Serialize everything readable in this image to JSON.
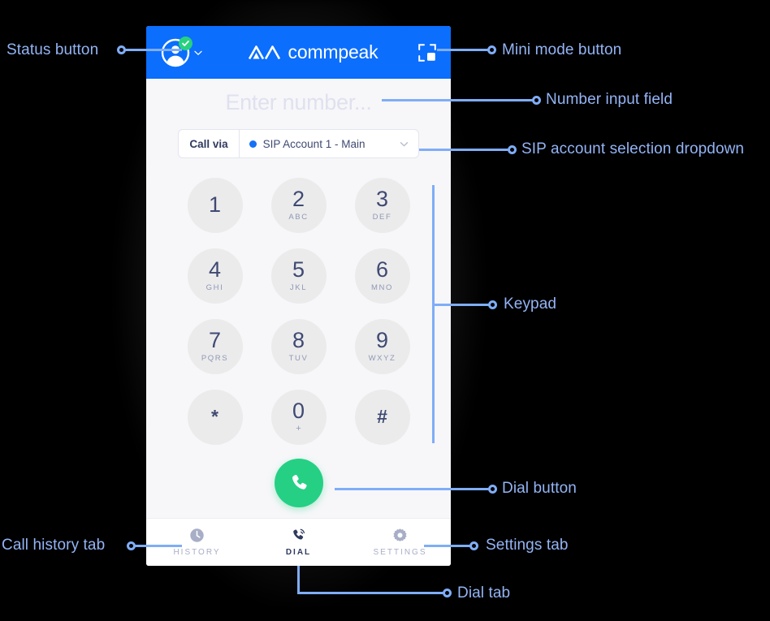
{
  "app": {
    "brand_name": "commpeak",
    "header": {
      "status_button_name": "status-button",
      "avatar_icon": "avatar-icon",
      "badge_icon": "check-badge-icon",
      "chevron_icon": "chevron-down-icon",
      "mini_mode_icon": "mini-mode-icon"
    },
    "number_input": {
      "value": "",
      "placeholder": "Enter number..."
    },
    "call_via": {
      "label": "Call via",
      "selected_account": "SIP Account 1 - Main",
      "status_dot_color": "#1571f5",
      "chevron_icon": "chevron-down-icon"
    },
    "keypad": {
      "keys": [
        {
          "digit": "1",
          "letters": ""
        },
        {
          "digit": "2",
          "letters": "ABC"
        },
        {
          "digit": "3",
          "letters": "DEF"
        },
        {
          "digit": "4",
          "letters": "GHI"
        },
        {
          "digit": "5",
          "letters": "JKL"
        },
        {
          "digit": "6",
          "letters": "MNO"
        },
        {
          "digit": "7",
          "letters": "PQRS"
        },
        {
          "digit": "8",
          "letters": "TUV"
        },
        {
          "digit": "9",
          "letters": "WXYZ"
        },
        {
          "digit": "*",
          "letters": ""
        },
        {
          "digit": "0",
          "letters": "+"
        },
        {
          "digit": "#",
          "letters": ""
        }
      ]
    },
    "dial_button": {
      "icon": "phone-icon",
      "color": "#25d084"
    },
    "tabs": [
      {
        "label": "HISTORY",
        "icon": "clock-icon",
        "active": false
      },
      {
        "label": "DIAL",
        "icon": "phone-call-icon",
        "active": true
      },
      {
        "label": "SETTINGS",
        "icon": "gear-icon",
        "active": false
      }
    ]
  },
  "annotations": {
    "accent_color": "#7fadf7",
    "text_color": "#93b4f5",
    "items": [
      {
        "id": "status-button",
        "label": "Status button"
      },
      {
        "id": "mini-mode-button",
        "label": "Mini mode button"
      },
      {
        "id": "number-input-field",
        "label": "Number input field"
      },
      {
        "id": "sip-account-dropdown",
        "label": "SIP account selection dropdown"
      },
      {
        "id": "keypad",
        "label": "Keypad"
      },
      {
        "id": "dial-button",
        "label": "Dial button"
      },
      {
        "id": "call-history-tab",
        "label": "Call history tab"
      },
      {
        "id": "settings-tab",
        "label": "Settings tab"
      },
      {
        "id": "dial-tab",
        "label": "Dial tab"
      }
    ]
  }
}
